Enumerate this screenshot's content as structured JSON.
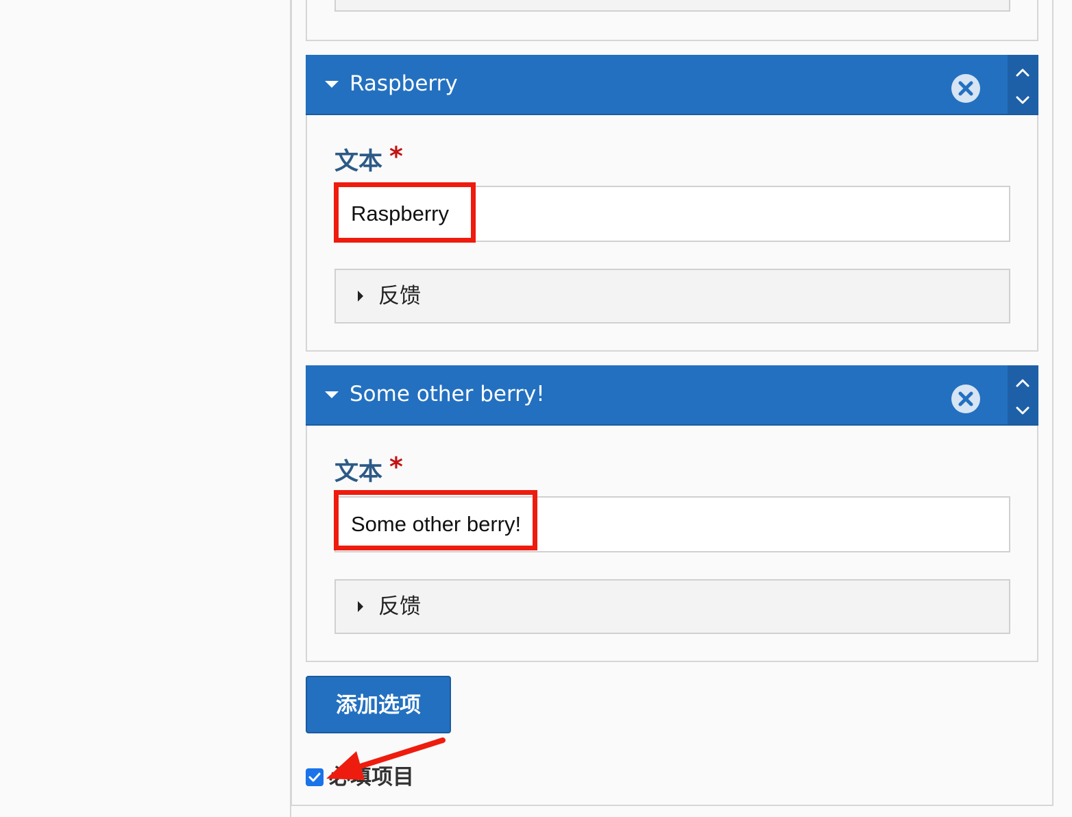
{
  "options": [
    {
      "title": "Raspberry",
      "field_label": "文本",
      "required_mark": "*",
      "text_value": "Raspberry",
      "feedback_label": "反馈"
    },
    {
      "title": "Some other berry!",
      "field_label": "文本",
      "required_mark": "*",
      "text_value": "Some other berry!",
      "feedback_label": "反馈"
    }
  ],
  "add_option_button": "添加选项",
  "required_checkbox": {
    "label": "必填项目",
    "checked": true
  },
  "icons": {
    "collapse": "caret-down-icon",
    "remove": "circle-x-icon",
    "move_up": "chevron-up-icon",
    "move_down": "chevron-down-icon",
    "expand_feedback": "caret-right-icon",
    "checkbox": "checkmark-icon",
    "annotation": "red-arrow-icon"
  },
  "colors": {
    "header_blue": "#2370c0",
    "label_blue": "#2d5a87",
    "required_red": "#c41212",
    "annotation_red": "#ee1c0e"
  }
}
